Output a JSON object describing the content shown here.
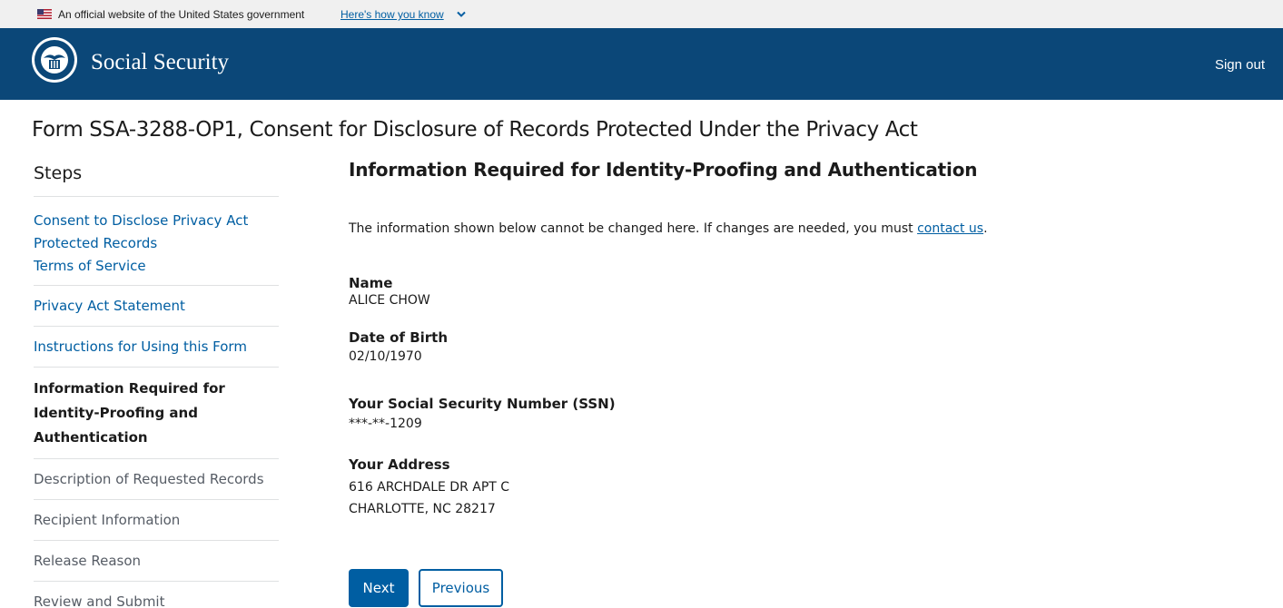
{
  "banner": {
    "text": "An official website of the United States government",
    "link": "Here's how you know"
  },
  "header": {
    "brand": "Social Security",
    "signout": "Sign out",
    "color": "#0b4778"
  },
  "page": {
    "title": "Form SSA-3288-OP1, Consent for Disclosure of Records Protected Under the Privacy Act"
  },
  "sidebar": {
    "heading": "Steps",
    "items": [
      {
        "line1": "Consent to Disclose Privacy Act",
        "line2": "Protected Records",
        "line3": "Terms of Service",
        "state": "link"
      },
      {
        "label": "Privacy Act Statement",
        "state": "link"
      },
      {
        "label": "Instructions for Using this Form",
        "state": "link"
      },
      {
        "line1": "Information Required for",
        "line2": "Identity-Proofing and",
        "line3": "Authentication",
        "state": "current"
      },
      {
        "label": "Description of Requested Records",
        "state": "muted"
      },
      {
        "label": "Recipient Information",
        "state": "muted"
      },
      {
        "label": "Release Reason",
        "state": "muted"
      },
      {
        "label": "Review and Submit",
        "state": "muted"
      }
    ]
  },
  "main": {
    "heading": "Information Required for Identity-Proofing and Authentication",
    "notice_text": "The information shown below cannot be changed here. If changes are needed, you must ",
    "notice_link": "contact us",
    "notice_end": ".",
    "fields": {
      "name_label": "Name",
      "name_value": "ALICE CHOW",
      "dob_label": "Date of Birth",
      "dob_value": "02/10/1970",
      "ssn_label": "Your Social Security Number (SSN)",
      "ssn_value": "***-**-1209",
      "address_label": "Your Address",
      "address_line1": "616 ARCHDALE DR APT C",
      "address_line2": "CHARLOTTE, NC 28217"
    },
    "next_label": "Next",
    "previous_label": "Previous"
  },
  "colors": {
    "link": "#005ea2",
    "banner_bg": "#f0f0f0"
  }
}
